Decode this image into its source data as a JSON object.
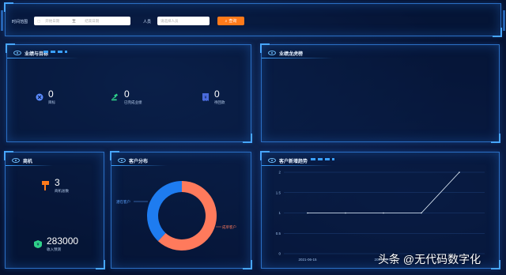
{
  "filters": {
    "time_label": "时间范围",
    "start_placeholder": "开始日期",
    "range_separator": "至",
    "end_placeholder": "结束日期",
    "person_label": "人员",
    "person_placeholder": "请选择人员",
    "query_label": "查询"
  },
  "panels": {
    "performance_goal": {
      "title": "业绩与目标",
      "stats": [
        {
          "icon": "target-icon",
          "value": "0",
          "label": "目标",
          "color": "#5b8cff"
        },
        {
          "icon": "gavel-icon",
          "value": "0",
          "label": "已完成业绩",
          "color": "#2fd18a"
        },
        {
          "icon": "receipt-icon",
          "value": "0",
          "label": "待回款",
          "color": "#4a6bdc"
        }
      ]
    },
    "performance_ranking": {
      "title": "业绩龙虎榜"
    },
    "opportunity": {
      "title": "商机",
      "stats": [
        {
          "icon": "flag-icon",
          "value": "3",
          "label": "商机总数",
          "color": "#ff7a1a"
        },
        {
          "icon": "yen-shield-icon",
          "value": "283000",
          "label": "收入预测",
          "color": "#2fd18a"
        }
      ]
    },
    "customer_distribution": {
      "title": "客户分布",
      "legend_left": "潜在客户",
      "legend_right": "成单客户"
    },
    "customer_trend": {
      "title": "客户新增趋势"
    }
  },
  "chart_data": [
    {
      "type": "pie",
      "categories": [
        "成单客户",
        "潜在客户"
      ],
      "values": [
        62,
        38
      ],
      "colors": [
        "#ff7a5c",
        "#1e7cf0"
      ],
      "donut": true
    },
    {
      "type": "line",
      "x": [
        "2021-06-15",
        "",
        "2021-06-17",
        "",
        ""
      ],
      "x_tick_labels": [
        "2021-06-15",
        "2021-06-17"
      ],
      "values": [
        1,
        1,
        1,
        1,
        2
      ],
      "ylim": [
        0,
        2
      ],
      "yticks": [
        0,
        0.5,
        1,
        1.5,
        2
      ],
      "grid": true,
      "color": "#e8f4ff"
    }
  ],
  "watermark": "头条 @无代码数字化"
}
